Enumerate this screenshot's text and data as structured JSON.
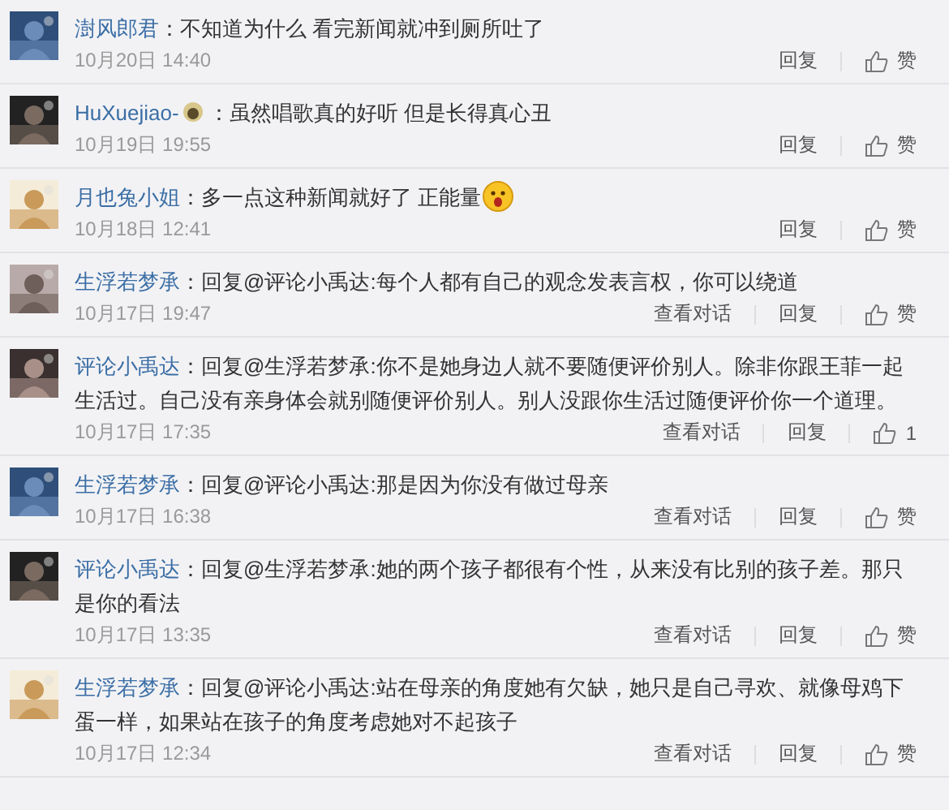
{
  "comments": [
    {
      "name": "澍风郎君",
      "name_badge": false,
      "text": "：不知道为什么 看完新闻就冲到厕所吐了",
      "emoji": false,
      "time": "10月20日 14:40",
      "actions": [
        "回复"
      ],
      "like": "赞"
    },
    {
      "name": "HuXuejiao-",
      "name_badge": true,
      "text": "：虽然唱歌真的好听 但是长得真心丑",
      "emoji": false,
      "time": "10月19日 19:55",
      "actions": [
        "回复"
      ],
      "like": "赞"
    },
    {
      "name": "月也兔小姐",
      "name_badge": false,
      "text": "：多一点这种新闻就好了 正能量",
      "emoji": true,
      "time": "10月18日 12:41",
      "actions": [
        "回复"
      ],
      "like": "赞"
    },
    {
      "name": "生浮若梦承",
      "name_badge": false,
      "text": "：回复@评论小禹达:每个人都有自己的观念发表言权，你可以绕道",
      "emoji": false,
      "time": "10月17日 19:47",
      "actions": [
        "查看对话",
        "回复"
      ],
      "like": "赞"
    },
    {
      "name": "评论小禹达",
      "name_badge": false,
      "text": "：回复@生浮若梦承:你不是她身边人就不要随便评价别人。除非你跟王菲一起生活过。自己没有亲身体会就别随便评价别人。别人没跟你生活过随便评价你一个道理。",
      "emoji": false,
      "time": "10月17日 17:35",
      "actions": [
        "查看对话",
        "回复"
      ],
      "like": "1"
    },
    {
      "name": "生浮若梦承",
      "name_badge": false,
      "text": "：回复@评论小禹达:那是因为你没有做过母亲",
      "emoji": false,
      "time": "10月17日 16:38",
      "actions": [
        "查看对话",
        "回复"
      ],
      "like": "赞"
    },
    {
      "name": "评论小禹达",
      "name_badge": false,
      "text": "：回复@生浮若梦承:她的两个孩子都很有个性，从来没有比别的孩子差。那只是你的看法",
      "emoji": false,
      "time": "10月17日 13:35",
      "actions": [
        "查看对话",
        "回复"
      ],
      "like": "赞"
    },
    {
      "name": "生浮若梦承",
      "name_badge": false,
      "text": "：回复@评论小禹达:站在母亲的角度她有欠缺，她只是自己寻欢、就像母鸡下蛋一样，如果站在孩子的角度考虑她对不起孩子",
      "emoji": false,
      "time": "10月17日 12:34",
      "actions": [
        "查看对话",
        "回复"
      ],
      "like": "赞"
    }
  ]
}
